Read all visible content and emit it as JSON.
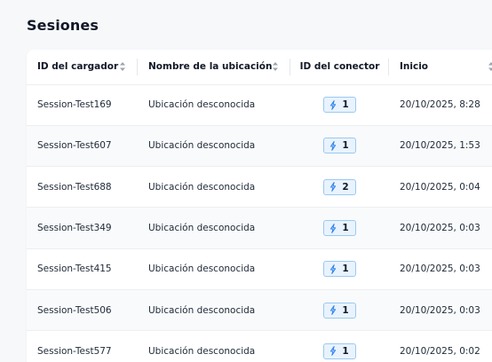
{
  "page": {
    "title": "Sesiones"
  },
  "colors": {
    "connector_bg": "#e8f3fd",
    "connector_border": "#9cc9f0",
    "bolt": "#2f80ed"
  },
  "table": {
    "columns": [
      {
        "label": "ID del cargador",
        "sortable": true
      },
      {
        "label": "Nombre de la ubicación",
        "sortable": true
      },
      {
        "label": "ID del conector",
        "sortable": false
      },
      {
        "label": "Inicio",
        "sortable": true
      }
    ],
    "rows": [
      {
        "charger_id": "Session-Test169",
        "location": "Ubicación desconocida",
        "connector_icon": "bolt-icon",
        "connector": "1",
        "start": "20/10/2025, 8:28"
      },
      {
        "charger_id": "Session-Test607",
        "location": "Ubicación desconocida",
        "connector_icon": "bolt-icon",
        "connector": "1",
        "start": "20/10/2025, 1:53"
      },
      {
        "charger_id": "Session-Test688",
        "location": "Ubicación desconocida",
        "connector_icon": "bolt-icon",
        "connector": "2",
        "start": "20/10/2025, 0:04"
      },
      {
        "charger_id": "Session-Test349",
        "location": "Ubicación desconocida",
        "connector_icon": "bolt-icon",
        "connector": "1",
        "start": "20/10/2025, 0:03"
      },
      {
        "charger_id": "Session-Test415",
        "location": "Ubicación desconocida",
        "connector_icon": "bolt-icon",
        "connector": "1",
        "start": "20/10/2025, 0:03"
      },
      {
        "charger_id": "Session-Test506",
        "location": "Ubicación desconocida",
        "connector_icon": "bolt-icon",
        "connector": "1",
        "start": "20/10/2025, 0:03"
      },
      {
        "charger_id": "Session-Test577",
        "location": "Ubicación desconocida",
        "connector_icon": "bolt-icon",
        "connector": "1",
        "start": "20/10/2025, 0:02"
      }
    ]
  }
}
